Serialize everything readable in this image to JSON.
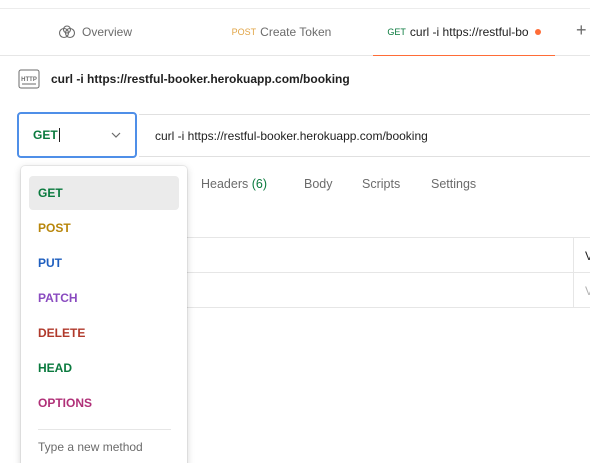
{
  "tabs": [
    {
      "label": "Overview",
      "method": "",
      "icon": "overview-icon"
    },
    {
      "label": "Create Token",
      "method": "POST",
      "method_color": "#e1a445"
    },
    {
      "label": "curl -i https://restful-bo",
      "method": "GET",
      "method_color": "#0a7a3e",
      "unsaved": true
    }
  ],
  "request": {
    "title": "curl -i https://restful-booker.herokuapp.com/booking",
    "method": "GET",
    "url": "curl -i https://restful-booker.herokuapp.com/booking"
  },
  "subtabs": {
    "headers": "Headers",
    "headers_count": "(6)",
    "body": "Body",
    "scripts": "Scripts",
    "settings": "Settings"
  },
  "table": {
    "header_partial": "V",
    "row_partial": "V"
  },
  "dropdown": {
    "options": [
      {
        "label": "GET",
        "color": "#0a7a3e"
      },
      {
        "label": "POST",
        "color": "#b8860b"
      },
      {
        "label": "PUT",
        "color": "#1f5fbf"
      },
      {
        "label": "PATCH",
        "color": "#8a4bc0"
      },
      {
        "label": "DELETE",
        "color": "#b0392b"
      },
      {
        "label": "HEAD",
        "color": "#0a7a3e"
      },
      {
        "label": "OPTIONS",
        "color": "#b03078"
      }
    ],
    "new_method_placeholder": "Type a new method"
  },
  "colors": {
    "accent": "#ff6c37",
    "focus_border": "#4f8fe8"
  }
}
